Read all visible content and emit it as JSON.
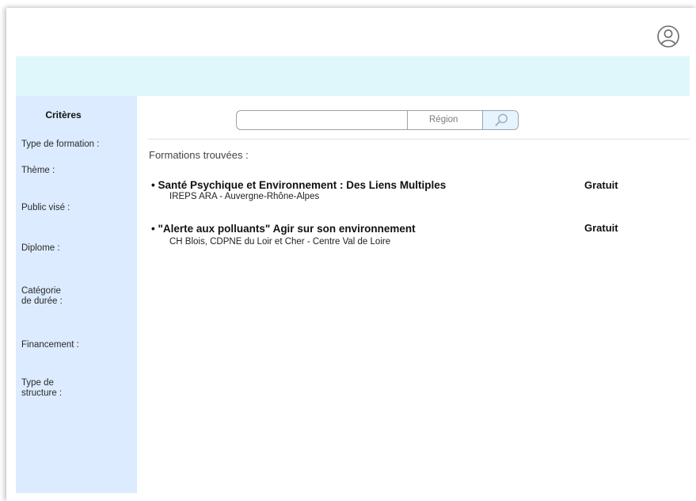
{
  "header": {
    "user_icon": "user-circle-icon"
  },
  "sidebar": {
    "title": "Critères",
    "criteria": [
      {
        "label": "Type de formation :"
      },
      {
        "label": "Thème :"
      },
      {
        "label": "Public visé :"
      },
      {
        "label": "Diplome :"
      },
      {
        "label": "Catégorie\nde durée :"
      },
      {
        "label": "Financement :"
      },
      {
        "label": "Type de\nstructure :"
      }
    ]
  },
  "search": {
    "value": "",
    "placeholder": "",
    "region_label": "Région",
    "button_icon": "search-icon"
  },
  "results": {
    "heading": "Formations trouvées :",
    "items": [
      {
        "title": "Santé Psychique et Environnement : Des Liens Multiples",
        "subtitle": "IREPS ARA - Auvergne-Rhône-Alpes",
        "price": "Gratuit"
      },
      {
        "title": "\"Alerte aux polluants\" Agir sur son environnement",
        "subtitle": "CH Blois, CDPNE du Loir et Cher - Centre Val de Loire",
        "price": "Gratuit"
      }
    ]
  },
  "colors": {
    "banner": "#dff7fa",
    "sidebar": "#dcebff",
    "search_button": "#e6f4ff"
  }
}
